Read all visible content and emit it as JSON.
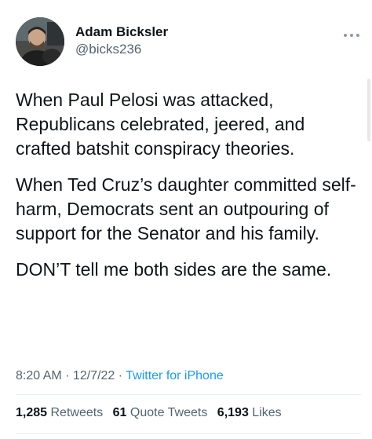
{
  "user": {
    "display_name": "Adam Bicksler",
    "handle": "@bicks236",
    "avatar_icon": "person-avatar"
  },
  "more_icon": "ellipsis-icon",
  "tweet": {
    "paragraphs": [
      "When Paul Pelosi was attacked, Republicans celebrated, jeered, and crafted batshit conspiracy theories.",
      "When Ted Cruz’s daughter committed self-harm, Democrats sent an outpouring of support for the Senator and his family.",
      "DON’T tell me both sides are the same."
    ]
  },
  "meta": {
    "time": "8:20 AM",
    "sep1": " · ",
    "date": "12/7/22",
    "sep2": " · ",
    "source": "Twitter for iPhone"
  },
  "stats": {
    "retweets_count": "1,285",
    "retweets_label": "Retweets",
    "quotes_count": "61",
    "quotes_label": "Quote Tweets",
    "likes_count": "6,193",
    "likes_label": "Likes"
  },
  "colors": {
    "text": "#0f1419",
    "secondary": "#536471",
    "link": "#1d9bf0",
    "divider": "#e6ecf0"
  }
}
